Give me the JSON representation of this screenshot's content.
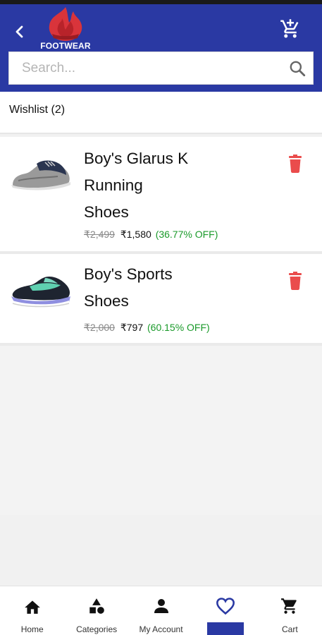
{
  "header": {
    "logo_text": "FOOTWEAR"
  },
  "search": {
    "placeholder": "Search..."
  },
  "wishlist": {
    "title": "Wishlist (2)",
    "items": [
      {
        "name_lines": [
          "Boy's Glarus K",
          "Running",
          "Shoes"
        ],
        "mrp": "₹2,499",
        "price": "₹1,580",
        "discount": "(36.77% OFF)"
      },
      {
        "name_lines": [
          "Boy's Sports",
          "Shoes"
        ],
        "mrp": "₹2,000",
        "price": "₹797",
        "discount": "(60.15% OFF)"
      }
    ]
  },
  "bottom_nav": {
    "items": [
      {
        "label": "Home",
        "icon": "home-icon"
      },
      {
        "label": "Categories",
        "icon": "categories-icon"
      },
      {
        "label": "My Account",
        "icon": "account-icon"
      },
      {
        "label": "",
        "icon": "heart-icon",
        "active": true
      },
      {
        "label": "Cart",
        "icon": "cart-icon"
      }
    ]
  },
  "colors": {
    "primary": "#2a39a3",
    "delete": "#ea4c4c",
    "discount": "#1a9a2a"
  }
}
